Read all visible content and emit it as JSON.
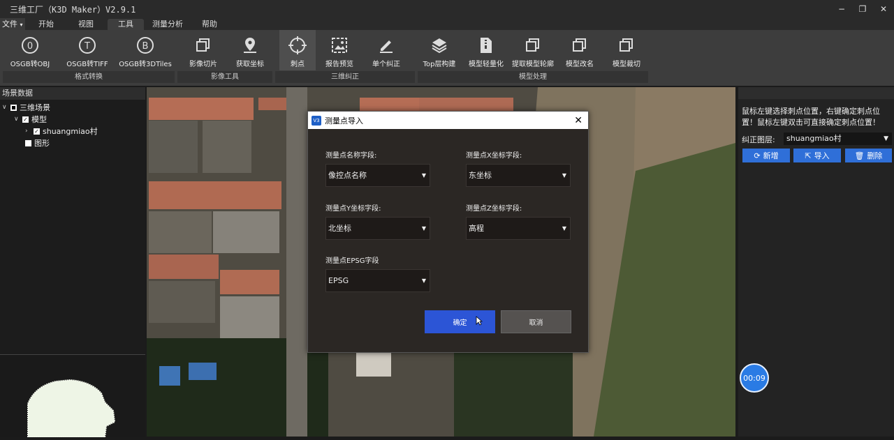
{
  "window": {
    "title": "三维工厂（K3D Maker）V2.9.1",
    "btn_min": "−",
    "btn_restore": "❐",
    "btn_close": "✕"
  },
  "menu": {
    "file": "文件",
    "tabs": [
      "开始",
      "视图",
      "工具",
      "测量分析",
      "帮助"
    ],
    "active": "工具"
  },
  "ribbon": {
    "buttons": [
      "OSGB转OBJ",
      "OSGB转TIFF",
      "OSGB转3DTiles",
      "影像切片",
      "获取坐标",
      "刺点",
      "报告预览",
      "单个纠正",
      "Top层构建",
      "模型轻量化",
      "提取模型轮廓",
      "模型改名",
      "模型裁切"
    ],
    "groups": [
      "格式转换",
      "影像工具",
      "三维纠正",
      "模型处理"
    ]
  },
  "left_panel": {
    "title": "场景数据",
    "tree": {
      "root": "三维场景",
      "model": "模型",
      "village": "shuangmiao村",
      "shape": "图形"
    }
  },
  "right_panel": {
    "instruction": "鼠标左键选择刺点位置，右键确定刺点位置！鼠标左键双击可直接确定刺点位置！",
    "layer_label": "纠正图层:",
    "layer_value": "shuangmiao村",
    "btn_new": "新增",
    "btn_import": "导入",
    "btn_delete": "删除"
  },
  "timer": "00:09",
  "dialog": {
    "title": "测量点导入",
    "name_label": "测量点名称字段:",
    "name_value": "像控点名称",
    "x_label": "测量点X坐标字段:",
    "x_value": "东坐标",
    "y_label": "测量点Y坐标字段:",
    "y_value": "北坐标",
    "z_label": "测量点Z坐标字段:",
    "z_value": "高程",
    "epsg_label": "测量点EPSG字段",
    "epsg_value": "EPSG",
    "ok": "确定",
    "cancel": "取消"
  },
  "colors": {
    "accent": "#2c55d6",
    "panel_button": "#2f6fd8",
    "background": "#1b1b1b"
  }
}
